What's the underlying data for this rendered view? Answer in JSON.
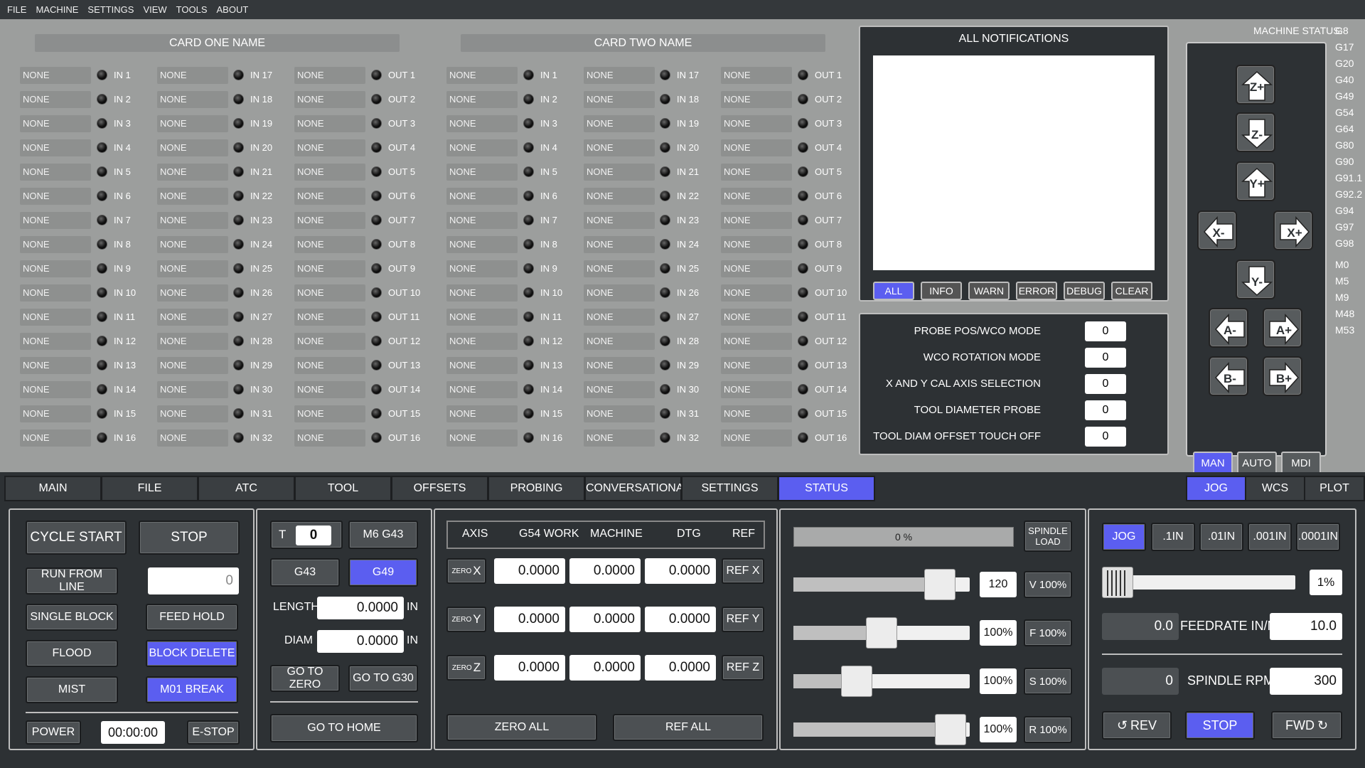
{
  "menu": [
    "FILE",
    "MACHINE",
    "SETTINGS",
    "VIEW",
    "TOOLS",
    "ABOUT"
  ],
  "cards": [
    {
      "title": "CARD ONE NAME"
    },
    {
      "title": "CARD TWO NAME"
    }
  ],
  "io_value": "NONE",
  "io_columns": [
    {
      "prefix": "IN ",
      "start": 1
    },
    {
      "prefix": "IN ",
      "start": 17
    },
    {
      "prefix": "OUT ",
      "start": 1
    }
  ],
  "notifications": {
    "title": "ALL NOTIFICATIONS",
    "buttons": [
      {
        "label": "ALL",
        "active": true
      },
      {
        "label": "INFO",
        "active": false
      },
      {
        "label": "WARN",
        "active": false
      },
      {
        "label": "ERROR",
        "active": false
      },
      {
        "label": "DEBUG",
        "active": false
      },
      {
        "label": "CLEAR",
        "active": false
      }
    ]
  },
  "probe_settings": [
    {
      "label": "PROBE POS/WCO MODE",
      "value": "0"
    },
    {
      "label": "WCO ROTATION MODE",
      "value": "0"
    },
    {
      "label": "X AND Y CAL AXIS SELECTION",
      "value": "0"
    },
    {
      "label": "TOOL DIAMETER PROBE",
      "value": "0"
    },
    {
      "label": "TOOL DIAM OFFSET TOUCH OFF",
      "value": "0"
    }
  ],
  "machine_status": {
    "title": "MACHINE STATUS:",
    "codes": [
      "G8",
      "G17",
      "G20",
      "G40",
      "G49",
      "G54",
      "G64",
      "G80",
      "G90",
      "G91.1",
      "G92.2",
      "G94",
      "G97",
      "G98",
      "M0",
      "M5",
      "M9",
      "M48",
      "M53"
    ]
  },
  "jog_buttons": [
    {
      "label": "Z+",
      "icon": "arrow-up-icon"
    },
    {
      "label": "Z-",
      "icon": "arrow-down-icon"
    },
    {
      "label": "Y+",
      "icon": "arrow-up-icon"
    },
    {
      "label": "X-",
      "icon": "arrow-left-icon"
    },
    {
      "label": "X+",
      "icon": "arrow-right-icon"
    },
    {
      "label": "Y-",
      "icon": "arrow-down-icon"
    },
    {
      "label": "A-",
      "icon": "arrow-left-icon"
    },
    {
      "label": "A+",
      "icon": "arrow-right-icon"
    },
    {
      "label": "B-",
      "icon": "arrow-left-icon"
    },
    {
      "label": "B+",
      "icon": "arrow-right-icon"
    }
  ],
  "modes": [
    {
      "label": "MAN",
      "active": true
    },
    {
      "label": "AUTO",
      "active": false
    },
    {
      "label": "MDI",
      "active": false
    }
  ],
  "tabs": [
    {
      "label": "MAIN",
      "active": false
    },
    {
      "label": "FILE",
      "active": false
    },
    {
      "label": "ATC",
      "active": false
    },
    {
      "label": "TOOL",
      "active": false
    },
    {
      "label": "OFFSETS",
      "active": false
    },
    {
      "label": "PROBING",
      "active": false
    },
    {
      "label": "CONVERSATIONAL",
      "active": false
    },
    {
      "label": "SETTINGS",
      "active": false
    },
    {
      "label": "STATUS",
      "active": true
    }
  ],
  "right_tabs": [
    {
      "label": "JOG",
      "active": true
    },
    {
      "label": "WCS",
      "active": false
    },
    {
      "label": "PLOT",
      "active": false
    }
  ],
  "program": {
    "cycle_start": "CYCLE START",
    "stop": "STOP",
    "run_from_line": "RUN FROM LINE",
    "run_line_value": "0",
    "single_block": "SINGLE BLOCK",
    "feed_hold": "FEED HOLD",
    "flood": "FLOOD",
    "block_delete": "BLOCK DELETE",
    "mist": "MIST",
    "m01_break": "M01 BREAK",
    "power": "POWER",
    "timer": "00:00:00",
    "estop": "E-STOP"
  },
  "tool": {
    "t_label": "T",
    "t_value": "0",
    "m6": "M6 G43",
    "g43": "G43",
    "g49": "G49",
    "length_label": "LENGTH",
    "length_value": "0.0000",
    "diam_label": "DIAM",
    "diam_value": "0.0000",
    "unit": "IN",
    "go_zero": "GO TO ZERO",
    "go_g30": "GO TO G30",
    "go_home": "GO TO HOME"
  },
  "dro": {
    "headers": [
      "AXIS",
      "G54 WORK",
      "MACHINE",
      "DTG",
      "REF"
    ],
    "zero_label": "ZERO",
    "axes": [
      {
        "axis": "X",
        "work": "0.0000",
        "machine": "0.0000",
        "dtg": "0.0000",
        "ref": "REF X"
      },
      {
        "axis": "Y",
        "work": "0.0000",
        "machine": "0.0000",
        "dtg": "0.0000",
        "ref": "REF Y"
      },
      {
        "axis": "Z",
        "work": "0.0000",
        "machine": "0.0000",
        "dtg": "0.0000",
        "ref": "REF Z"
      }
    ],
    "zero_all": "ZERO ALL",
    "ref_all": "REF ALL"
  },
  "overrides": {
    "spindle_load_value": "0 %",
    "spindle_load_btn": "SPINDLE LOAD",
    "sliders": [
      {
        "value": "120",
        "button": "V 100%",
        "fraction": 0.83
      },
      {
        "value": "100%",
        "button": "F 100%",
        "fraction": 0.5
      },
      {
        "value": "100%",
        "button": "S 100%",
        "fraction": 0.36
      },
      {
        "value": "100%",
        "button": "R 100%",
        "fraction": 0.89
      }
    ]
  },
  "jog": {
    "increments": [
      {
        "label": "JOG",
        "active": true
      },
      {
        "label": ".1IN",
        "active": false
      },
      {
        "label": ".01IN",
        "active": false
      },
      {
        "label": ".001IN",
        "active": false
      },
      {
        "label": ".0001IN",
        "active": false
      }
    ],
    "rate_value": "1%",
    "feed_current": "0.0",
    "feed_label": "FEEDRATE IN/M",
    "feed_value": "10.0",
    "rpm_current": "0",
    "rpm_label": "SPINDLE RPM",
    "rpm_value": "300",
    "rev": "REV",
    "stop": "STOP",
    "fwd": "FWD",
    "rev_icon": "rotate-ccw-icon",
    "fwd_icon": "rotate-cw-icon"
  },
  "colors": {
    "accent": "#5b5ef0",
    "panel": "#2d3134",
    "light_panel": "#9c9e9d"
  }
}
